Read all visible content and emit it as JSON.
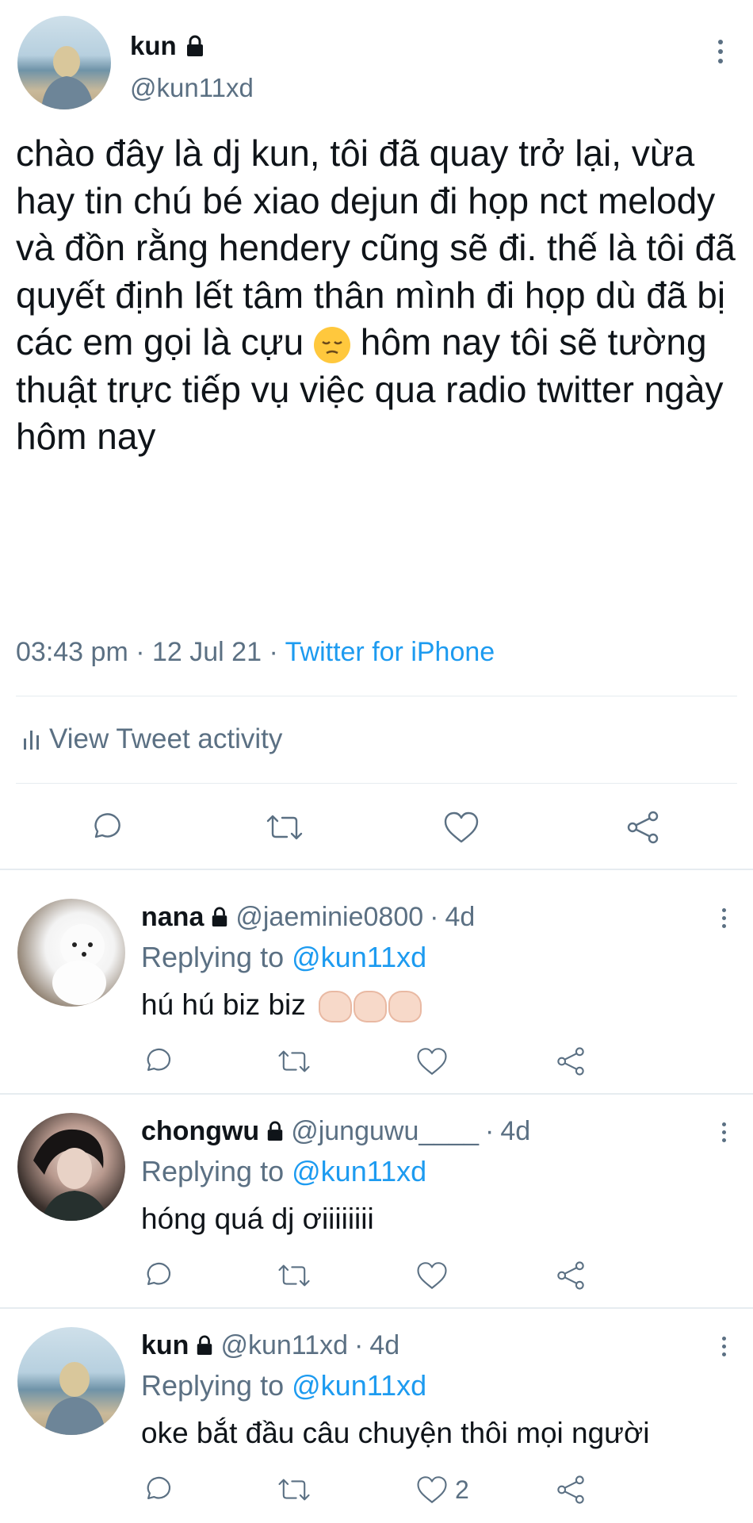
{
  "main_tweet": {
    "name": "kun",
    "handle": "@kun11xd",
    "text": "chào đây là dj kun, tôi đã quay trở lại, vừa hay tin chú bé xiao dejun đi họp nct melody và đồn rằng hendery cũng sẽ đi. thế là tôi đã quyết định lết tâm thân mình đi họp dù đã bị các em gọi là cựu",
    "text_after_emoji": "hôm nay tôi sẽ tường thuật trực tiếp vụ việc qua radio twitter ngày hôm nay",
    "time": "03:43 pm",
    "date": "12 Jul 21",
    "source": "Twitter for iPhone",
    "activity_label": "View Tweet activity"
  },
  "replies": [
    {
      "name": "nana",
      "handle": "@jaeminie0800",
      "age": "4d",
      "replying_prefix": "Replying to",
      "replying_to": "@kun11xd",
      "text": "hú hú biz biz",
      "like_count": ""
    },
    {
      "name": "chongwu",
      "handle": "@junguwu____",
      "age": "4d",
      "replying_prefix": "Replying to",
      "replying_to": "@kun11xd",
      "text": "hóng quá dj ơiiiiiiii",
      "like_count": ""
    },
    {
      "name": "kun",
      "handle": "@kun11xd",
      "age": "4d",
      "replying_prefix": "Replying to",
      "replying_to": "@kun11xd",
      "text": "oke bắt đầu câu chuyện thôi mọi người",
      "like_count": "2"
    }
  ],
  "separators": {
    "dot": "·"
  },
  "icons": [
    "lock-icon",
    "more-icon",
    "reply-icon",
    "retweet-icon",
    "like-icon",
    "share-icon",
    "activity-icon",
    "pensive-emoji",
    "clap-emoji"
  ]
}
